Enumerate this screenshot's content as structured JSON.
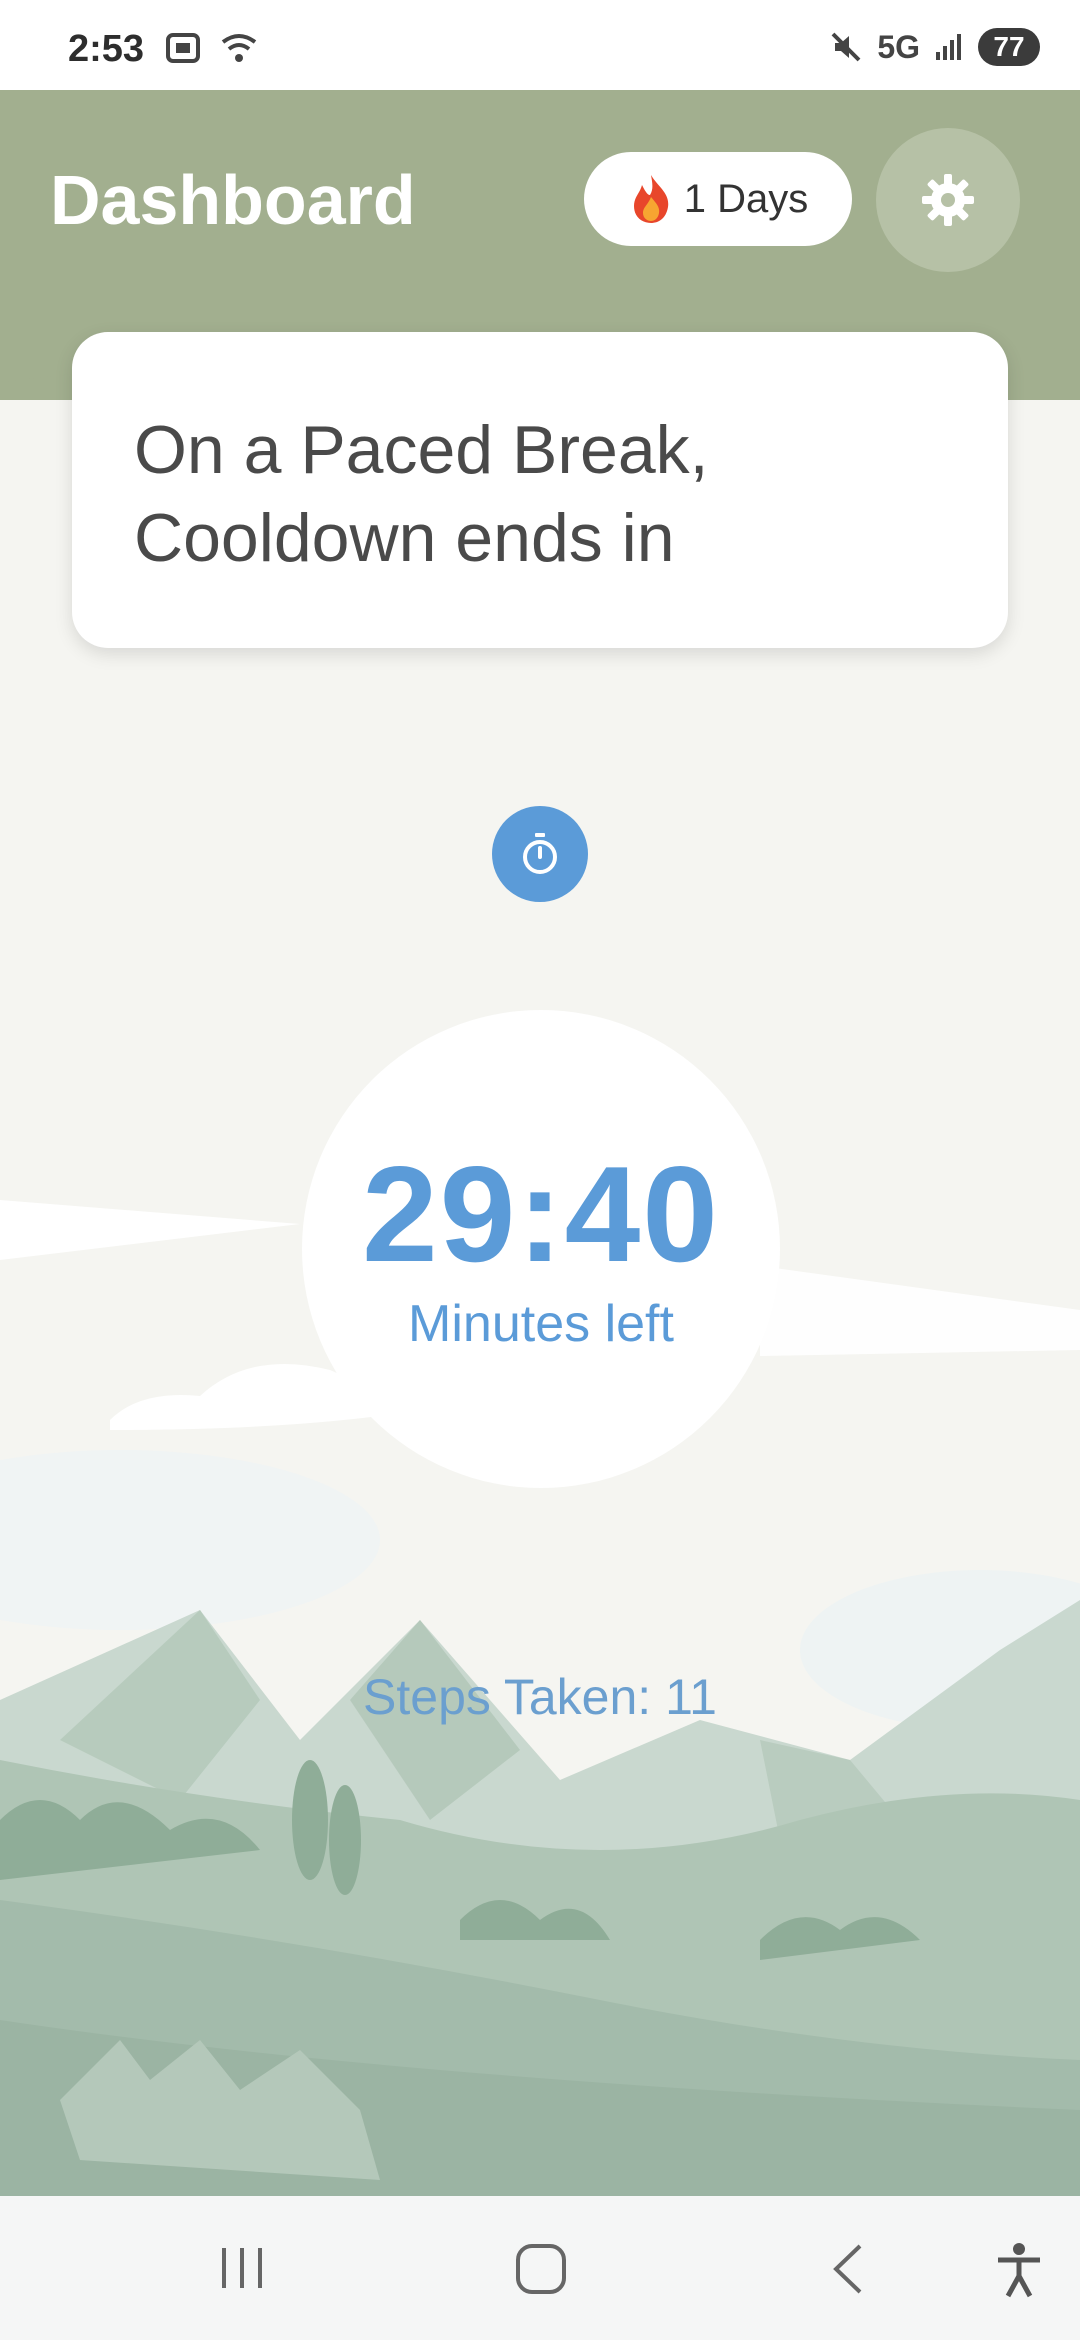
{
  "status_bar": {
    "time": "2:53",
    "network": "5G",
    "battery": "77",
    "icons": [
      "screenshot-icon",
      "wifi-icon",
      "mute-icon",
      "signal-icon",
      "battery-icon"
    ]
  },
  "header": {
    "title": "Dashboard",
    "streak_label": "1 Days",
    "streak_icon": "fire-icon",
    "settings_icon": "gear-icon"
  },
  "status_card": {
    "line1": "On a Paced Break,",
    "line2": "Cooldown ends in"
  },
  "countdown": {
    "time": "29:40",
    "label": "Minutes left",
    "icon": "stopwatch-icon"
  },
  "steps": {
    "text": "Steps Taken: 11"
  },
  "nav_bar": {
    "items": [
      "recent-apps-icon",
      "home-icon",
      "back-icon",
      "accessibility-icon"
    ]
  },
  "colors": {
    "header_green": "#a2af8f",
    "accent_blue": "#5b9bd8",
    "background": "#f5f5f1"
  }
}
